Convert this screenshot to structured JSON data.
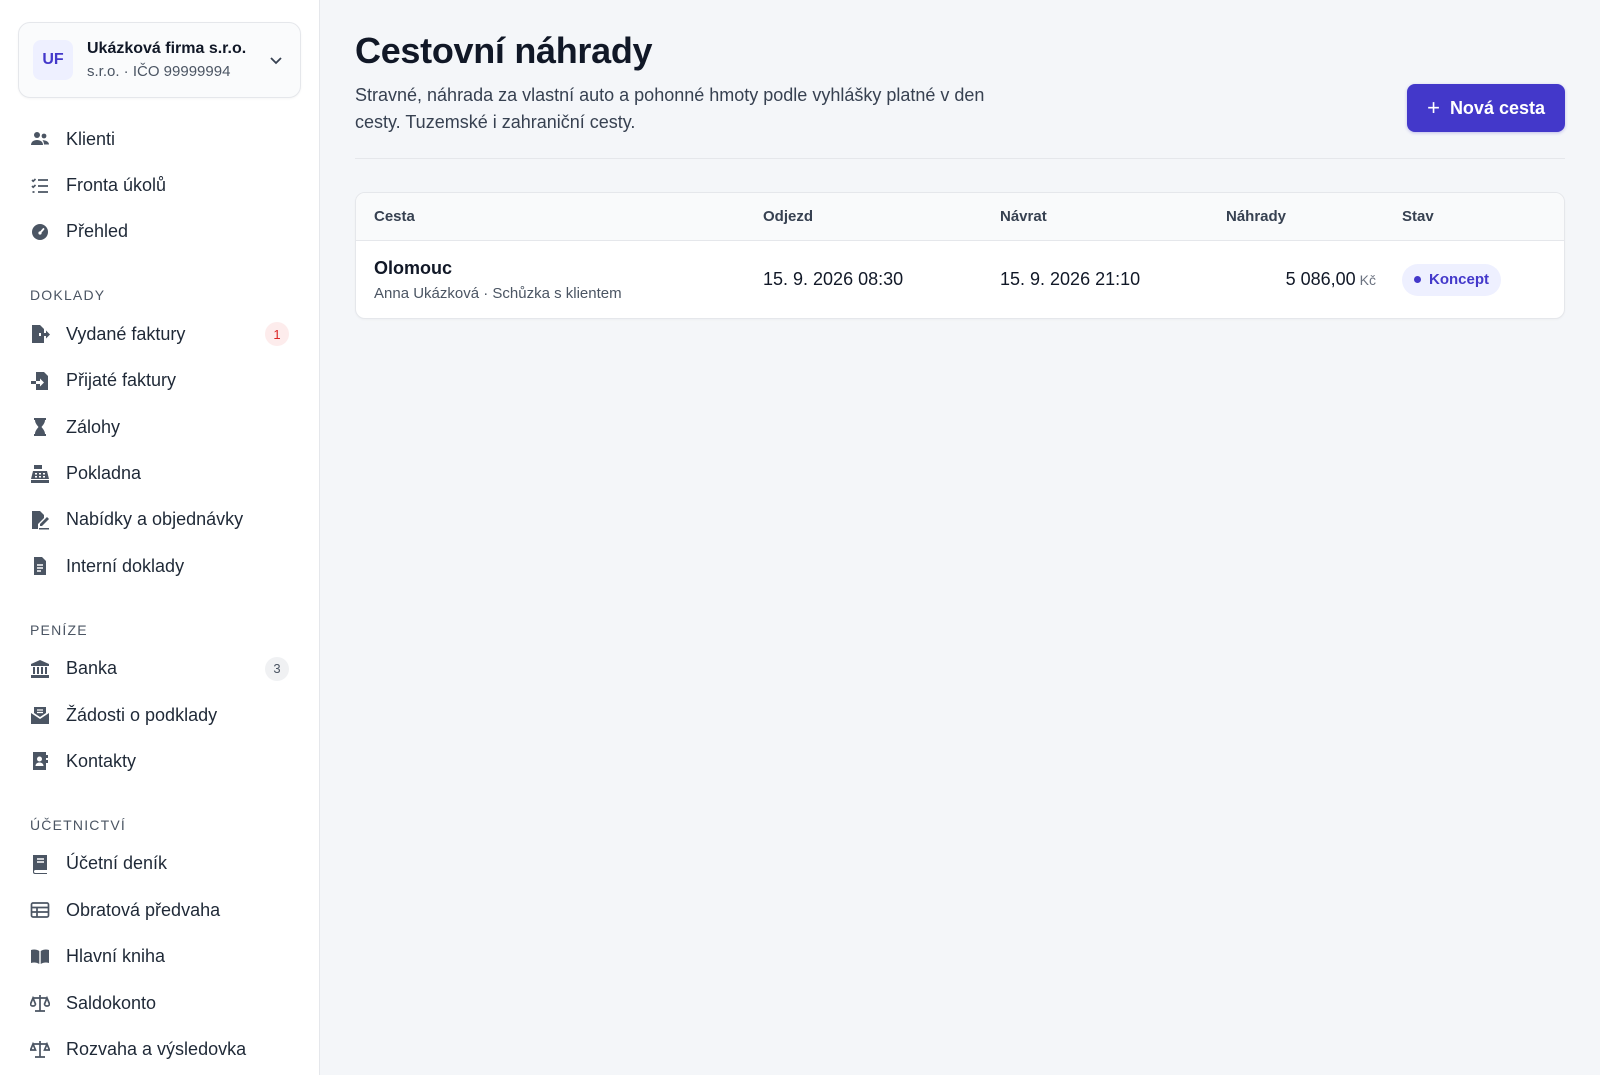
{
  "company": {
    "initials": "UF",
    "name": "Ukázková firma s.r.o.",
    "subtitle": "s.r.o. · IČO 99999994"
  },
  "nav": {
    "top": [
      {
        "label": "Klienti",
        "icon": "users-icon"
      },
      {
        "label": "Fronta úkolů",
        "icon": "task-list-icon"
      },
      {
        "label": "Přehled",
        "icon": "gauge-icon"
      }
    ],
    "sections": [
      {
        "title": "DOKLADY",
        "items": [
          {
            "label": "Vydané faktury",
            "icon": "invoice-out-icon",
            "badge": "1"
          },
          {
            "label": "Přijaté faktury",
            "icon": "invoice-in-icon"
          },
          {
            "label": "Zálohy",
            "icon": "hourglass-icon"
          },
          {
            "label": "Pokladna",
            "icon": "cash-register-icon"
          },
          {
            "label": "Nabídky a objednávky",
            "icon": "file-signature-icon"
          },
          {
            "label": "Interní doklady",
            "icon": "document-icon"
          }
        ]
      },
      {
        "title": "PENÍZE",
        "items": [
          {
            "label": "Banka",
            "icon": "bank-icon",
            "badge": "3"
          },
          {
            "label": "Žádosti o podklady",
            "icon": "envelope-open-icon"
          },
          {
            "label": "Kontakty",
            "icon": "address-book-icon"
          }
        ]
      },
      {
        "title": "ÚČETNICTVÍ",
        "items": [
          {
            "label": "Účetní deník",
            "icon": "book-icon"
          },
          {
            "label": "Obratová předvaha",
            "icon": "table-icon"
          },
          {
            "label": "Hlavní kniha",
            "icon": "book-open-icon"
          },
          {
            "label": "Saldokonto",
            "icon": "scale-icon"
          },
          {
            "label": "Rozvaha a výsledovka",
            "icon": "scale-balanced-icon"
          }
        ]
      }
    ]
  },
  "page": {
    "title": "Cestovní náhrady",
    "subtitle": "Stravné, náhrada za vlastní auto a pohonné hmoty podle vyhlášky platné v den cesty. Tuzemské i zahraniční cesty.",
    "new_button": "Nová cesta"
  },
  "table": {
    "columns": [
      "Cesta",
      "Odjezd",
      "Návrat",
      "Náhrady",
      "Stav"
    ],
    "rows": [
      {
        "name": "Olomouc",
        "meta": "Anna Ukázková · Schůzka s klientem",
        "departure": "15. 9. 2026 08:30",
        "return": "15. 9. 2026 21:10",
        "amount": "5 086,00",
        "currency": "Kč",
        "status": "Koncept"
      }
    ]
  },
  "colors": {
    "accent": "#4338ca",
    "badge_red": "#dc2626"
  }
}
